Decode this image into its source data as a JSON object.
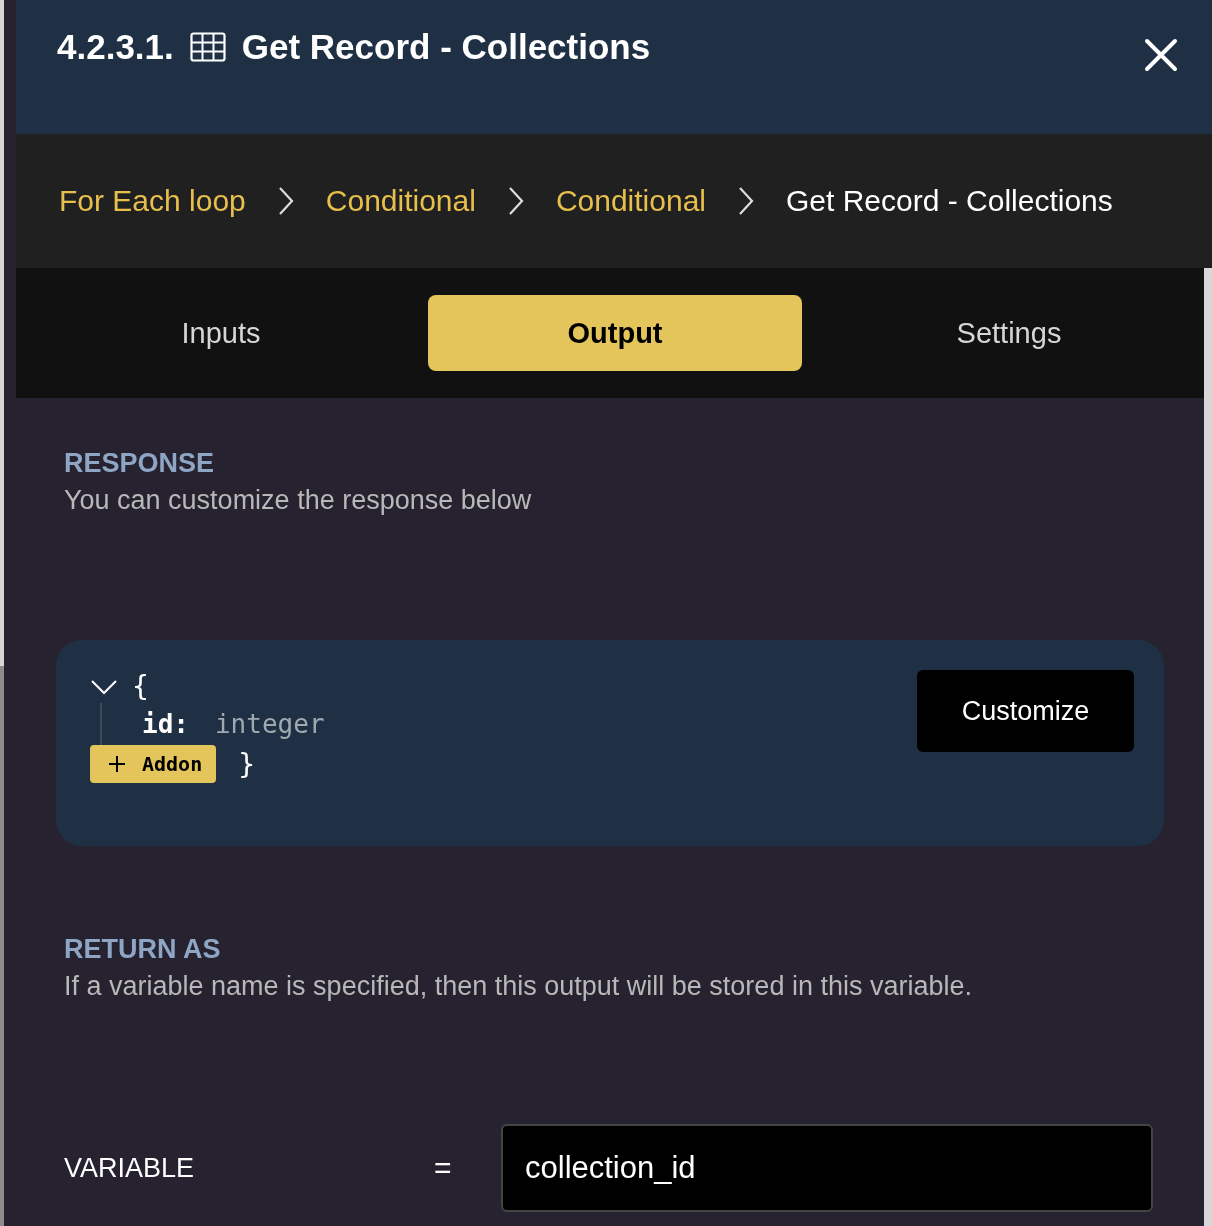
{
  "header": {
    "number": "4.2.3.1.",
    "title": "Get Record - Collections"
  },
  "breadcrumb": [
    {
      "label": "For Each loop",
      "current": false
    },
    {
      "label": "Conditional",
      "current": false
    },
    {
      "label": "Conditional",
      "current": false
    },
    {
      "label": "Get Record - Collections",
      "current": true
    }
  ],
  "tabs": [
    {
      "label": "Inputs",
      "selected": false
    },
    {
      "label": "Output",
      "selected": true
    },
    {
      "label": "Settings",
      "selected": false
    }
  ],
  "response": {
    "heading": "RESPONSE",
    "description": "You can customize the response below",
    "expanded": true,
    "open_brace": "{",
    "close_brace": "}",
    "fields": [
      {
        "key": "id:",
        "type": "integer"
      }
    ],
    "addon_button": "Addon",
    "customize_button": "Customize"
  },
  "return_as": {
    "heading": "RETURN AS",
    "description": "If a variable name is specified, then this output will be stored in this variable.",
    "variable_label": "VARIABLE",
    "equals": "=",
    "variable_value": "collection_id"
  }
}
